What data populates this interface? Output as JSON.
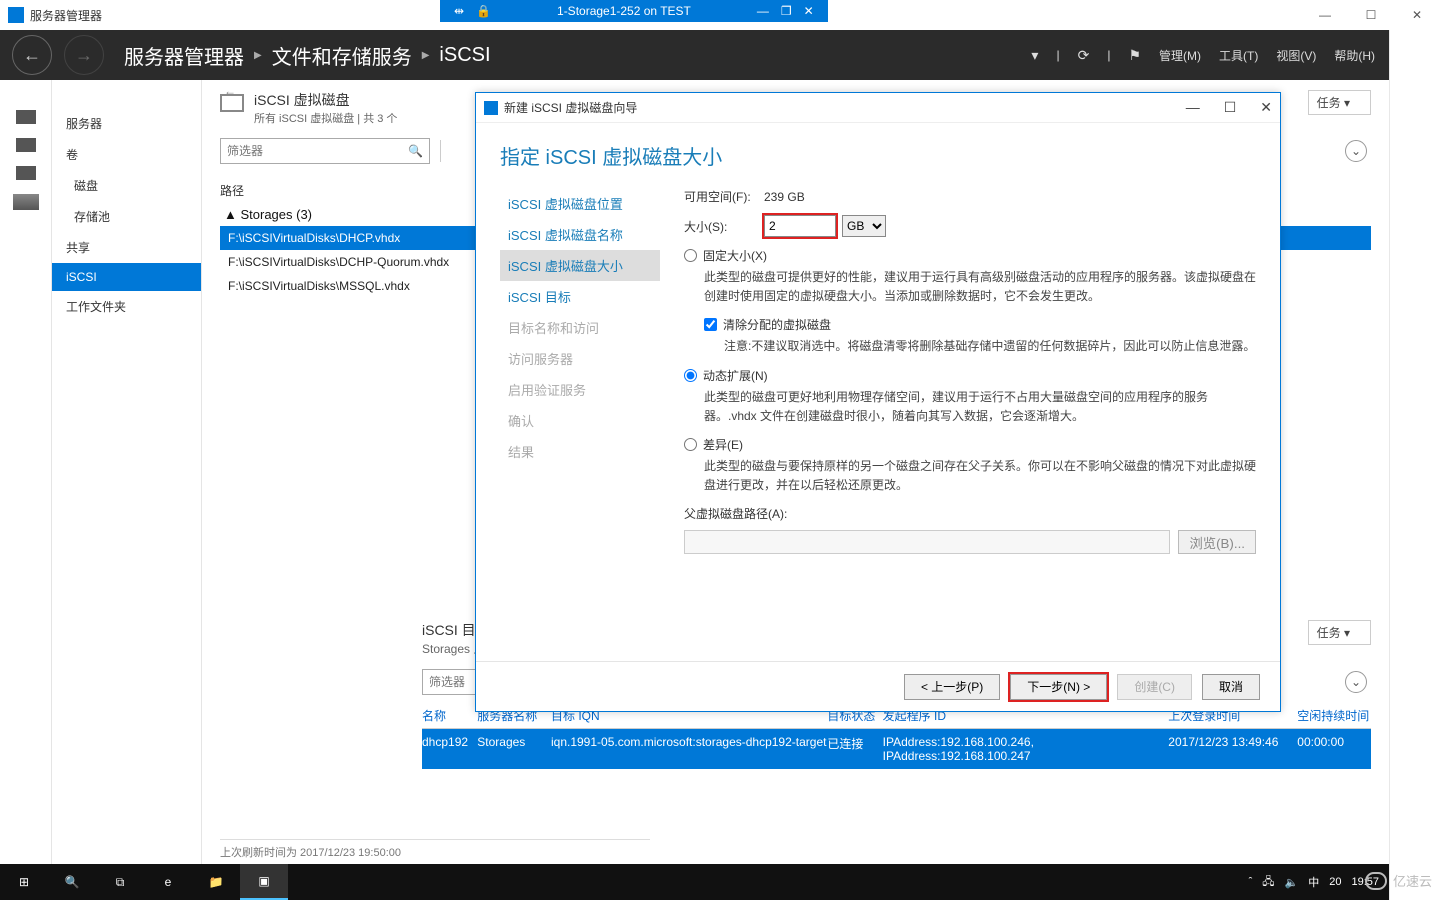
{
  "rdp": {
    "title": "1-Storage1-252 on TEST"
  },
  "outer": {
    "title": "服务器管理器"
  },
  "header": {
    "bc1": "服务器管理器",
    "bc2": "文件和存储服务",
    "bc3": "iSCSI",
    "menu_manage": "管理(M)",
    "menu_tools": "工具(T)",
    "menu_view": "视图(V)",
    "menu_help": "帮助(H)"
  },
  "sidebar": {
    "items": [
      "服务器",
      "卷",
      "磁盘",
      "存储池",
      "共享",
      "iSCSI",
      "工作文件夹"
    ],
    "selected_index": 5
  },
  "pane": {
    "title": "iSCSI 虚拟磁盘",
    "subtitle": "所有 iSCSI 虚拟磁盘 | 共 3 个",
    "tasks": "任务",
    "filter_ph": "筛选器",
    "path_hdr": "路径",
    "group": "Storages (3)",
    "rows": [
      "F:\\iSCSIVirtualDisks\\DHCP.vhdx",
      "F:\\iSCSIVirtualDisks\\DCHP-Quorum.vhdx",
      "F:\\iSCSIVirtualDisks\\MSSQL.vhdx"
    ],
    "refresh": "上次刷新时间为 2017/12/23 19:50:00"
  },
  "target_pane": {
    "title": "iSCSI 目标",
    "subtitle": "Storages 上的 F:\\iSCSIVirtualDisks\\DHCP.vhdx",
    "tasks": "任务",
    "filter_ph": "筛选器",
    "cols": [
      "名称",
      "服务器名称",
      "目标 IQN",
      "目标状态",
      "发起程序 ID",
      "上次登录时间",
      "空闲持续时间"
    ],
    "row": [
      "dhcp192",
      "Storages",
      "iqn.1991-05.com.microsoft:storages-dhcp192-target",
      "已连接",
      "IPAddress:192.168.100.246, IPAddress:192.168.100.247",
      "2017/12/23 13:49:46",
      "00:00:00"
    ]
  },
  "wizard": {
    "title": "新建 iSCSI 虚拟磁盘向导",
    "heading": "指定 iSCSI 虚拟磁盘大小",
    "steps": [
      "iSCSI 虚拟磁盘位置",
      "iSCSI 虚拟磁盘名称",
      "iSCSI 虚拟磁盘大小",
      "iSCSI 目标",
      "目标名称和访问",
      "访问服务器",
      "启用验证服务",
      "确认",
      "结果"
    ],
    "selected_step": 2,
    "free_label": "可用空间(F):",
    "free_value": "239 GB",
    "size_label": "大小(S):",
    "size_value": "2",
    "size_unit": "GB",
    "opt_fixed": "固定大小(X)",
    "opt_fixed_desc": "此类型的磁盘可提供更好的性能，建议用于运行具有高级别磁盘活动的应用程序的服务器。该虚拟硬盘在创建时使用固定的虚拟硬盘大小。当添加或删除数据时，它不会发生更改。",
    "chk_clear": "清除分配的虚拟磁盘",
    "chk_clear_desc": "注意:不建议取消选中。将磁盘清零将删除基础存储中遗留的任何数据碎片，因此可以防止信息泄露。",
    "opt_dyn": "动态扩展(N)",
    "opt_dyn_desc": "此类型的磁盘可更好地利用物理存储空间，建议用于运行不占用大量磁盘空间的应用程序的服务器。.vhdx 文件在创建磁盘时很小，随着向其写入数据，它会逐渐增大。",
    "opt_diff": "差异(E)",
    "opt_diff_desc": "此类型的磁盘与要保持原样的另一个磁盘之间存在父子关系。你可以在不影响父磁盘的情况下对此虚拟硬盘进行更改，并在以后轻松还原更改。",
    "parent_label": "父虚拟磁盘路径(A):",
    "browse": "浏览(B)...",
    "btn_prev": "< 上一步(P)",
    "btn_next": "下一步(N) >",
    "btn_create": "创建(C)",
    "btn_cancel": "取消"
  },
  "taskbar": {
    "time": "19:57",
    "ime": "中",
    "num": "20"
  },
  "watermark": "亿速云"
}
